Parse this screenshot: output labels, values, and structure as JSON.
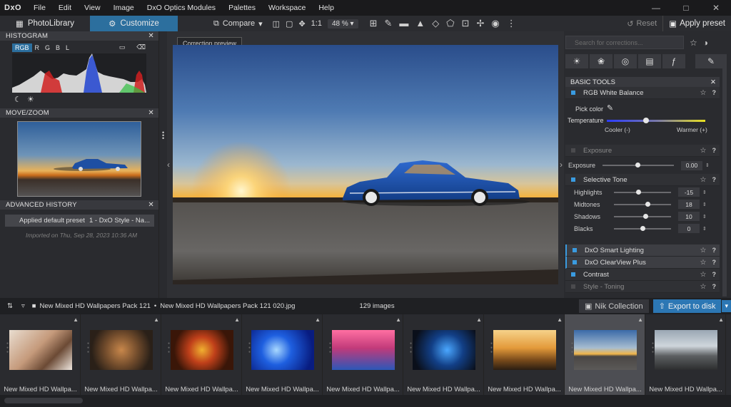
{
  "menubar": {
    "logo": "DxO",
    "items": [
      "File",
      "Edit",
      "View",
      "Image",
      "DxO Optics Modules",
      "Palettes",
      "Workspace",
      "Help"
    ]
  },
  "toolbar": {
    "tab_photolibrary": "PhotoLibrary",
    "tab_customize": "Customize",
    "compare": "Compare",
    "one_to_one": "1:1",
    "zoom": "48 %",
    "reset": "Reset",
    "apply_preset": "Apply preset"
  },
  "histogram": {
    "title": "HISTOGRAM",
    "channels": [
      "RGB",
      "R",
      "G",
      "B",
      "L"
    ]
  },
  "move_zoom": {
    "title": "MOVE/ZOOM"
  },
  "advanced_history": {
    "title": "ADVANCED HISTORY",
    "row_action": "Applied default preset",
    "row_preset": "1 - DxO Style - Na...",
    "imported": "Imported on Thu, Sep 28, 2023 10:36 AM"
  },
  "center": {
    "tooltip": "Correction preview"
  },
  "right_panel": {
    "search_placeholder": "Search for corrections...",
    "basic_tools_title": "BASIC TOOLS",
    "rgb_white_balance": "RGB White Balance",
    "pick_color": "Pick color",
    "temperature": "Temperature",
    "cooler": "Cooler (-)",
    "warmer": "Warmer (+)",
    "exposure_title": "Exposure",
    "exposure_label": "Exposure",
    "exposure_value": "0.00",
    "selective_tone": "Selective Tone",
    "sliders": [
      {
        "label": "Highlights",
        "value": "-15",
        "pos": 0.42
      },
      {
        "label": "Midtones",
        "value": "18",
        "pos": 0.59
      },
      {
        "label": "Shadows",
        "value": "10",
        "pos": 0.55
      },
      {
        "label": "Blacks",
        "value": "0",
        "pos": 0.5
      }
    ],
    "smart_lighting": "DxO Smart Lighting",
    "clearview": "DxO ClearView Plus",
    "contrast": "Contrast",
    "style_toning": "Style - Toning"
  },
  "filmstrip": {
    "folder": "New Mixed HD Wallpapers Pack 121",
    "file": "New Mixed HD Wallpapers Pack 121 020.jpg",
    "count": "129 images",
    "nik": "Nik Collection",
    "export": "Export to disk",
    "captions": [
      "New Mixed HD Wallpa...",
      "New Mixed HD Wallpa...",
      "New Mixed HD Wallpa...",
      "New Mixed HD Wallpa...",
      "New Mixed HD Wallpa...",
      "New Mixed HD Wallpa...",
      "New Mixed HD Wallpa...",
      "New Mixed HD Wallpa...",
      "New Mixed HD Wallpa..."
    ]
  },
  "colors": {
    "accent": "#2c6f9e",
    "export": "#2c77b4",
    "checkbox_on": "#3a9be0"
  }
}
